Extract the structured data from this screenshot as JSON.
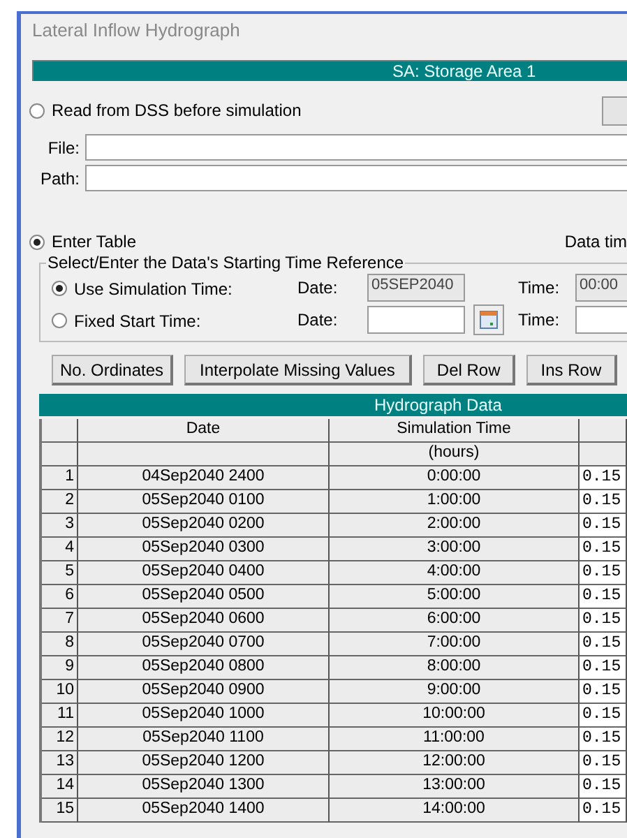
{
  "window": {
    "title": "Lateral Inflow Hydrograph"
  },
  "banner": "SA: Storage Area 1",
  "dss_option": {
    "label": "Read from DSS before simulation",
    "selected": false
  },
  "dss_fields": [
    {
      "label": "File:"
    },
    {
      "label": "Path:"
    }
  ],
  "table_option": {
    "label": "Enter Table",
    "selected": true
  },
  "data_time_label": "Data tim",
  "time_reference": {
    "legend": "Select/Enter the Data's Starting Time Reference",
    "options": [
      {
        "label": "Use Simulation Time:",
        "selected": true,
        "date_label": "Date:",
        "date": "05SEP2040",
        "time_label": "Time:",
        "time": "00:00",
        "disabled": true
      },
      {
        "label": "Fixed Start Time:",
        "selected": false,
        "date_label": "Date:",
        "time_label": "Time:",
        "disabled": false
      }
    ]
  },
  "buttons": [
    "No. Ordinates",
    "Interpolate Missing Values",
    "Del Row",
    "Ins Row"
  ],
  "table": {
    "title": "Hydrograph Data",
    "columns": [
      {
        "label": "Date"
      },
      {
        "label": "Simulation Time",
        "unit": "(hours)"
      }
    ],
    "rows": [
      {
        "number": "1",
        "date": "04Sep2040 2400",
        "time": "0:00:00",
        "value": "0.15"
      },
      {
        "number": "2",
        "date": "05Sep2040 0100",
        "time": "1:00:00",
        "value": "0.15"
      },
      {
        "number": "3",
        "date": "05Sep2040 0200",
        "time": "2:00:00",
        "value": "0.15"
      },
      {
        "number": "4",
        "date": "05Sep2040 0300",
        "time": "3:00:00",
        "value": "0.15"
      },
      {
        "number": "5",
        "date": "05Sep2040 0400",
        "time": "4:00:00",
        "value": "0.15"
      },
      {
        "number": "6",
        "date": "05Sep2040 0500",
        "time": "5:00:00",
        "value": "0.15"
      },
      {
        "number": "7",
        "date": "05Sep2040 0600",
        "time": "6:00:00",
        "value": "0.15"
      },
      {
        "number": "8",
        "date": "05Sep2040 0700",
        "time": "7:00:00",
        "value": "0.15"
      },
      {
        "number": "9",
        "date": "05Sep2040 0800",
        "time": "8:00:00",
        "value": "0.15"
      },
      {
        "number": "10",
        "date": "05Sep2040 0900",
        "time": "9:00:00",
        "value": "0.15"
      },
      {
        "number": "11",
        "date": "05Sep2040 1000",
        "time": "10:00:00",
        "value": "0.15"
      },
      {
        "number": "12",
        "date": "05Sep2040 1100",
        "time": "11:00:00",
        "value": "0.15"
      },
      {
        "number": "13",
        "date": "05Sep2040 1200",
        "time": "12:00:00",
        "value": "0.15"
      },
      {
        "number": "14",
        "date": "05Sep2040 1300",
        "time": "13:00:00",
        "value": "0.15"
      },
      {
        "number": "15",
        "date": "05Sep2040 1400",
        "time": "14:00:00",
        "value": "0.15"
      }
    ]
  }
}
